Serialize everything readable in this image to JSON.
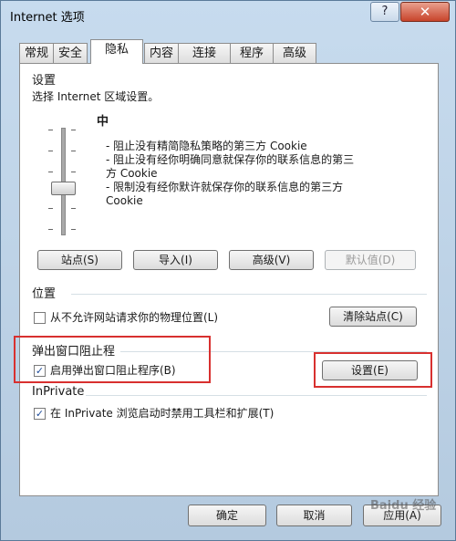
{
  "window": {
    "title": "Internet 选项",
    "help_label": "?",
    "close_label": "✕"
  },
  "tabs": [
    "常规",
    "安全",
    "隐私",
    "内容",
    "连接",
    "程序",
    "高级"
  ],
  "active_tab": "隐私",
  "settings": {
    "heading": "设置",
    "instruction": "选择 Internet 区域设置。",
    "level": "中",
    "desc_line1": "- 阻止没有精简隐私策略的第三方 Cookie",
    "desc_line2": "- 阻止没有经你明确同意就保存你的联系信息的第三",
    "desc_line3": "方 Cookie",
    "desc_line4": "- 限制没有经你默许就保存你的联系信息的第三方",
    "desc_line5": "Cookie",
    "buttons": {
      "sites": "站点(S)",
      "import": "导入(I)",
      "advanced": "高级(V)",
      "default": "默认值(D)"
    }
  },
  "location": {
    "heading": "位置",
    "checkbox_label": "从不允许网站请求你的物理位置(L)",
    "checked": false,
    "clear_button": "清除站点(C)"
  },
  "popup": {
    "heading": "弹出窗口阻止程",
    "checkbox_label": "启用弹出窗口阻止程序(B)",
    "checked": true,
    "settings_button": "设置(E)"
  },
  "inprivate": {
    "heading": "InPrivate",
    "checkbox_label": "在 InPrivate 浏览启动时禁用工具栏和扩展(T)",
    "checked": true
  },
  "footer": {
    "ok": "确定",
    "cancel": "取消",
    "apply": "应用(A)"
  },
  "watermark": "Baidu 经验",
  "colors": {
    "highlight_box": "#d8302f",
    "close_button": "#c8442b",
    "window_frame": "#b4cadf"
  }
}
